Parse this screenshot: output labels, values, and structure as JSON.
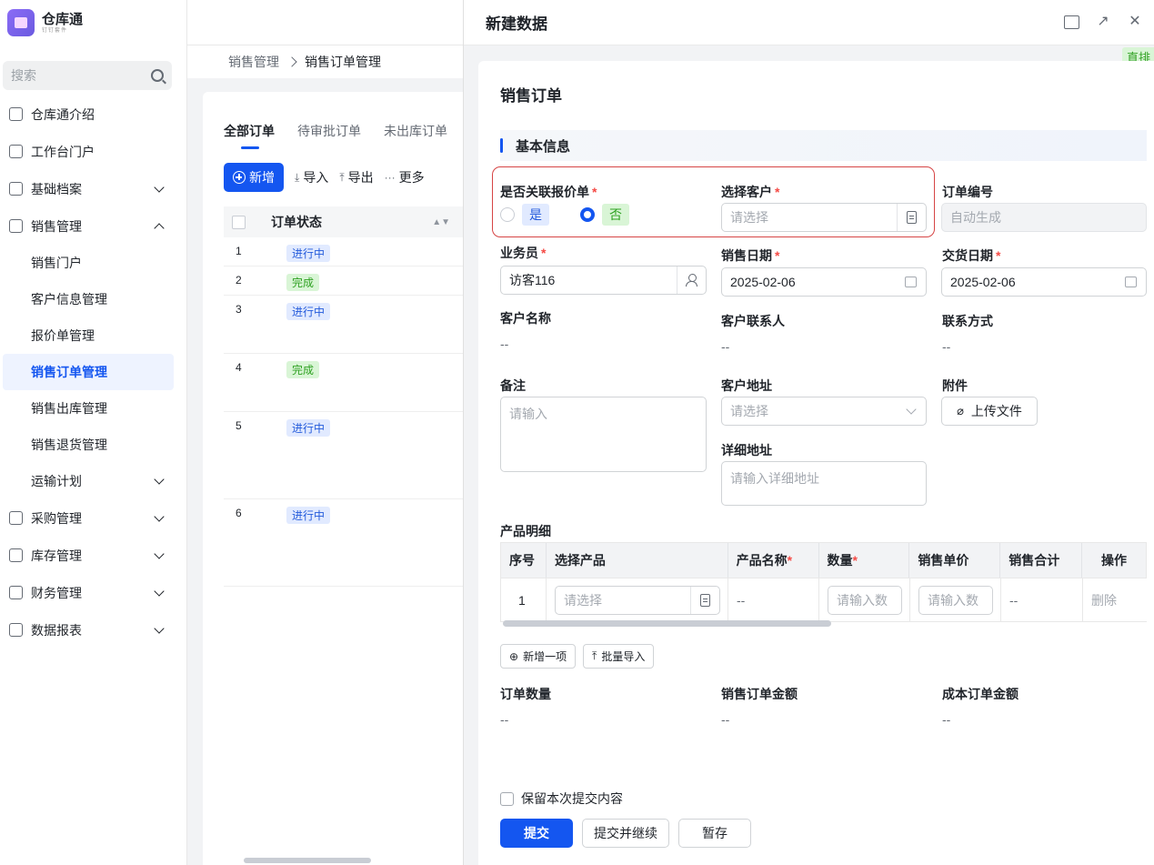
{
  "app": {
    "title": "仓库通",
    "subtitle": "钉钉套件"
  },
  "sidebar": {
    "search_placeholder": "搜索",
    "items": [
      {
        "label": "仓库通介绍",
        "icon": "home-icon"
      },
      {
        "label": "工作台门户",
        "icon": "grid-icon"
      },
      {
        "label": "基础档案",
        "icon": "cube-icon"
      },
      {
        "label": "销售管理",
        "icon": "user-icon"
      }
    ],
    "sub_items": [
      "销售门户",
      "客户信息管理",
      "报价单管理",
      "销售订单管理",
      "销售出库管理",
      "销售退货管理",
      "运输计划"
    ],
    "items_after": [
      {
        "label": "采购管理",
        "icon": "bag-icon"
      },
      {
        "label": "库存管理",
        "icon": "warehouse-icon"
      },
      {
        "label": "财务管理",
        "icon": "finance-icon"
      },
      {
        "label": "数据报表",
        "icon": "database-icon"
      }
    ]
  },
  "breadcrumb": {
    "parent": "销售管理",
    "current": "销售订单管理"
  },
  "list": {
    "tabs": [
      "全部订单",
      "待审批订单",
      "未出库订单"
    ],
    "toolbar": {
      "add": "新增",
      "import": "导入",
      "export": "导出",
      "more": "更多"
    },
    "column_status": "订单状态",
    "rows": [
      {
        "idx": "1",
        "status": "进行中",
        "kind": "run"
      },
      {
        "idx": "2",
        "status": "完成",
        "kind": "done"
      },
      {
        "idx": "3",
        "status": "进行中",
        "kind": "run"
      },
      {
        "idx": "4",
        "status": "完成",
        "kind": "done"
      },
      {
        "idx": "5",
        "status": "进行中",
        "kind": "run"
      },
      {
        "idx": "6",
        "status": "进行中",
        "kind": "run"
      }
    ]
  },
  "drawer": {
    "title": "新建数据",
    "side_tag": "直排",
    "form_title": "销售订单",
    "section": "基本信息",
    "fields": {
      "link_quote": {
        "label": "是否关联报价单",
        "yes": "是",
        "no": "否"
      },
      "customer": {
        "label": "选择客户",
        "placeholder": "请选择"
      },
      "order_no": {
        "label": "订单编号",
        "value": "自动生成"
      },
      "salesman": {
        "label": "业务员",
        "value": "访客116"
      },
      "sale_date": {
        "label": "销售日期",
        "value": "2025-02-06"
      },
      "delivery_date": {
        "label": "交货日期",
        "value": "2025-02-06"
      },
      "customer_name": {
        "label": "客户名称",
        "value": "--"
      },
      "contact": {
        "label": "客户联系人",
        "value": "--"
      },
      "phone": {
        "label": "联系方式",
        "value": "--"
      },
      "remark": {
        "label": "备注",
        "placeholder": "请输入"
      },
      "address": {
        "label": "客户地址",
        "placeholder": "请选择"
      },
      "attachment": {
        "label": "附件",
        "button": "上传文件"
      },
      "detail_address": {
        "label": "详细地址",
        "placeholder": "请输入详细地址"
      }
    },
    "products": {
      "label": "产品明细",
      "columns": {
        "no": "序号",
        "product": "选择产品",
        "name": "产品名称",
        "qty": "数量",
        "price": "销售单价",
        "total": "销售合计",
        "action": "操作"
      },
      "row": {
        "no": "1",
        "product_ph": "请选择",
        "name": "--",
        "qty_ph": "请输入数",
        "price_ph": "请输入数",
        "total": "--",
        "action": "删除"
      },
      "add_row": "新增一项",
      "batch_import": "批量导入"
    },
    "summary": {
      "qty": {
        "label": "订单数量",
        "value": "--"
      },
      "amount": {
        "label": "销售订单金额",
        "value": "--"
      },
      "cost": {
        "label": "成本订单金额",
        "value": "--"
      }
    },
    "keep_content": "保留本次提交内容",
    "buttons": {
      "submit": "提交",
      "submit_continue": "提交并继续",
      "draft": "暂存"
    }
  }
}
